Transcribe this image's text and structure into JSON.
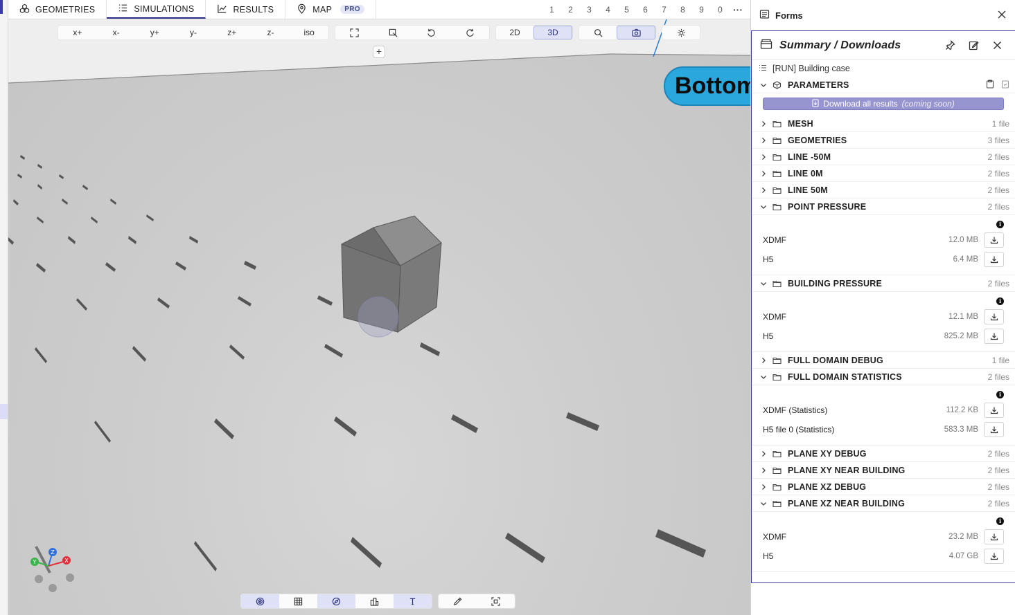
{
  "topnav": {
    "tabs": [
      {
        "label": "GEOMETRIES",
        "icon": "cubes-icon"
      },
      {
        "label": "SIMULATIONS",
        "icon": "list-icon",
        "active": true
      },
      {
        "label": "RESULTS",
        "icon": "chart-line-icon"
      },
      {
        "label": "MAP",
        "icon": "map-pin-icon",
        "badge": "PRO"
      }
    ],
    "number_tabs": [
      "1",
      "2",
      "3",
      "4",
      "5",
      "6",
      "7",
      "8",
      "9",
      "0"
    ],
    "more": "···"
  },
  "view_toolbar": {
    "axis_buttons": [
      "x+",
      "x-",
      "y+",
      "y-",
      "z+",
      "z-",
      "iso"
    ],
    "mode_buttons": [
      "2D",
      "3D"
    ],
    "active_mode": "3D"
  },
  "viewport": {
    "bottom_label": "Bottom",
    "plus": "+",
    "axis_letters": {
      "x": "X",
      "y": "Y",
      "z": "Z"
    }
  },
  "forms_panel": {
    "title": "Forms"
  },
  "summary": {
    "title": "Summary / Downloads",
    "run_case": "[RUN] Building case",
    "parameters_label": "PARAMETERS",
    "download_all": "Download all results",
    "download_all_note": "(coming soon)",
    "sections": [
      {
        "label": "MESH",
        "count": "1 file",
        "expanded": false
      },
      {
        "label": "GEOMETRIES",
        "count": "3 files",
        "expanded": false
      },
      {
        "label": "LINE -50M",
        "count": "2 files",
        "expanded": false
      },
      {
        "label": "LINE 0M",
        "count": "2 files",
        "expanded": false
      },
      {
        "label": "LINE 50M",
        "count": "2 files",
        "expanded": false
      },
      {
        "label": "POINT PRESSURE",
        "count": "2 files",
        "expanded": true,
        "files": [
          {
            "name": "XDMF",
            "size": "12.0 MB"
          },
          {
            "name": "H5",
            "size": "6.4 MB"
          }
        ]
      },
      {
        "label": "BUILDING PRESSURE",
        "count": "2 files",
        "expanded": true,
        "files": [
          {
            "name": "XDMF",
            "size": "12.1 MB"
          },
          {
            "name": "H5",
            "size": "825.2 MB"
          }
        ]
      },
      {
        "label": "FULL DOMAIN DEBUG",
        "count": "1 file",
        "expanded": false
      },
      {
        "label": "FULL DOMAIN STATISTICS",
        "count": "2 files",
        "expanded": true,
        "files": [
          {
            "name": "XDMF (Statistics)",
            "size": "112.2 KB"
          },
          {
            "name": "H5 file 0 (Statistics)",
            "size": "583.3 MB"
          }
        ]
      },
      {
        "label": "PLANE XY DEBUG",
        "count": "2 files",
        "expanded": false
      },
      {
        "label": "PLANE XY NEAR BUILDING",
        "count": "2 files",
        "expanded": false
      },
      {
        "label": "PLANE XZ DEBUG",
        "count": "2 files",
        "expanded": false
      },
      {
        "label": "PLANE XZ NEAR BUILDING",
        "count": "2 files",
        "expanded": true,
        "files": [
          {
            "name": "XDMF",
            "size": "23.2 MB"
          },
          {
            "name": "H5",
            "size": "4.07 GB"
          }
        ]
      }
    ]
  },
  "colors": {
    "accent": "#2c2c8a",
    "active_bg": "#dfe2f7",
    "download_all_bg": "#9795cf",
    "bottom_label_bg": "#2aa7dd",
    "axis_x": "#e0303a",
    "axis_y": "#39b54a",
    "axis_z": "#2f6fe0"
  }
}
